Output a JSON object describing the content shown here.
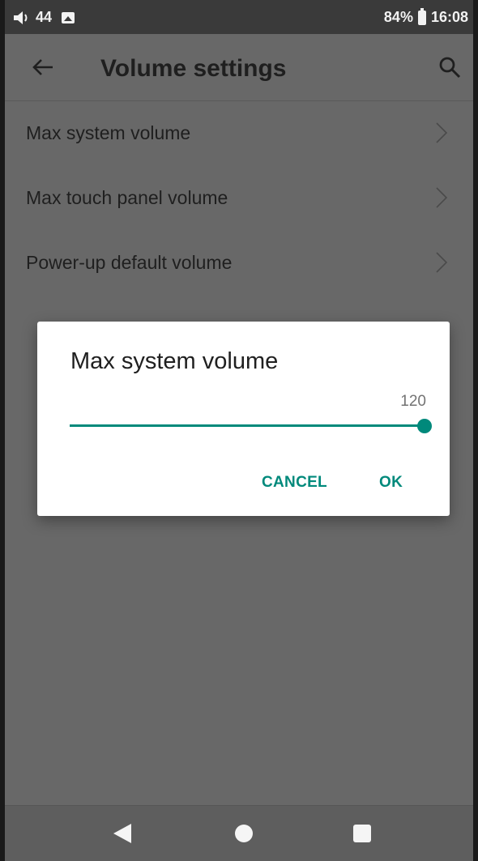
{
  "status_bar": {
    "volume_level": "44",
    "battery": "84%",
    "time": "16:08",
    "icons": [
      "volume-icon",
      "image-notification-icon",
      "battery-charging-icon"
    ]
  },
  "app_bar": {
    "title": "Volume settings",
    "icons": [
      "back-arrow-icon",
      "search-icon"
    ]
  },
  "list": {
    "items": [
      {
        "label": "Max system volume"
      },
      {
        "label": "Max touch panel volume"
      },
      {
        "label": "Power-up default volume"
      }
    ],
    "chevron_icon": "chevron-right-icon"
  },
  "dialog": {
    "title": "Max system volume",
    "value": "120",
    "slider": {
      "value": 120,
      "max": 120,
      "fraction": 1.0
    },
    "cancel_label": "CANCEL",
    "ok_label": "OK",
    "accent_color": "#00897b"
  },
  "nav_bar": {
    "icons": [
      "nav-back-icon",
      "nav-home-icon",
      "nav-recents-icon"
    ]
  }
}
